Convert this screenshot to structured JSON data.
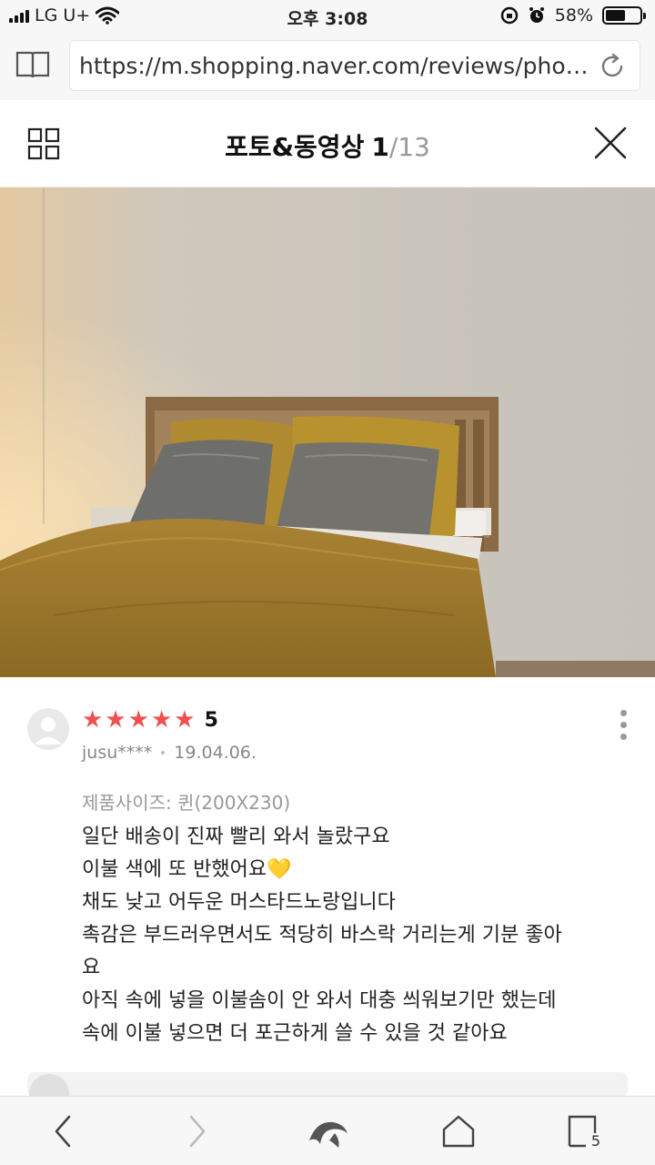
{
  "status_bar": {
    "carrier": "LG U+",
    "time": "오후 3:08",
    "battery_percent": "58%",
    "battery_level": 0.58
  },
  "browser": {
    "url": "https://m.shopping.naver.com/reviews/phot..."
  },
  "header": {
    "title": "포토&동영상",
    "current_index": "1",
    "total": "/13"
  },
  "review": {
    "rating": "5",
    "stars": 5,
    "user": "jusu****",
    "date": "19.04.06.",
    "option": "제품사이즈: 퀸(200X230)",
    "lines": [
      "일단 배송이 진짜 빨리 와서 놀랐구요",
      "이불 색에 또 반했어요💛",
      "채도 낮고 어두운 머스타드노랑입니다",
      "촉감은 부드러우면서도 적당히 바스락 거리는게 기분 좋아",
      "요",
      "아직 속에 넣을 이불솜이 안 와서 대충 씌워보기만 했는데",
      "속에 이불 넣으면 더 포근하게 쓸 수 있을 것 같아요"
    ]
  },
  "toolbar": {
    "tabs_count": "5"
  },
  "icons": {
    "book": "book-icon",
    "reload": "reload-icon",
    "grid": "grid-icon",
    "close": "close-icon",
    "more": "more-icon",
    "back": "back-icon",
    "forward": "forward-icon",
    "whale": "whale-icon",
    "home": "home-icon",
    "tabs": "tabs-icon"
  }
}
